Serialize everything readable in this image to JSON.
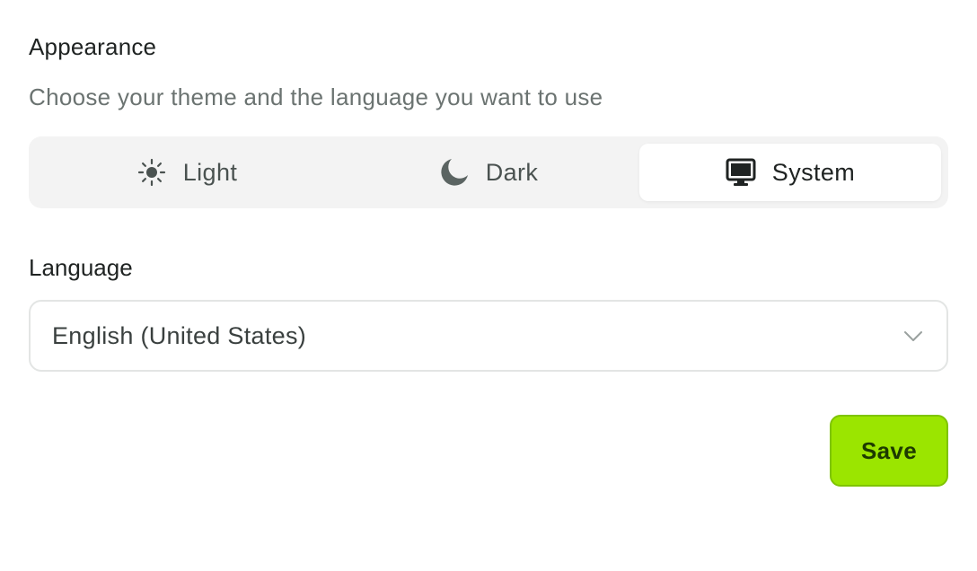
{
  "appearance": {
    "title": "Appearance",
    "description": "Choose your theme and the language you want to use",
    "themes": [
      {
        "label": "Light",
        "icon": "sun-icon",
        "selected": false
      },
      {
        "label": "Dark",
        "icon": "moon-icon",
        "selected": false
      },
      {
        "label": "System",
        "icon": "monitor-icon",
        "selected": true
      }
    ]
  },
  "language": {
    "label": "Language",
    "selected_value": "English (United States)",
    "dropdown_icon": "chevron-down-icon"
  },
  "actions": {
    "save_label": "Save"
  },
  "colors": {
    "accent": "#9be500",
    "accent_border": "#7fc400",
    "toggle_bg": "#f3f3f3",
    "muted_text": "#6b7371"
  }
}
